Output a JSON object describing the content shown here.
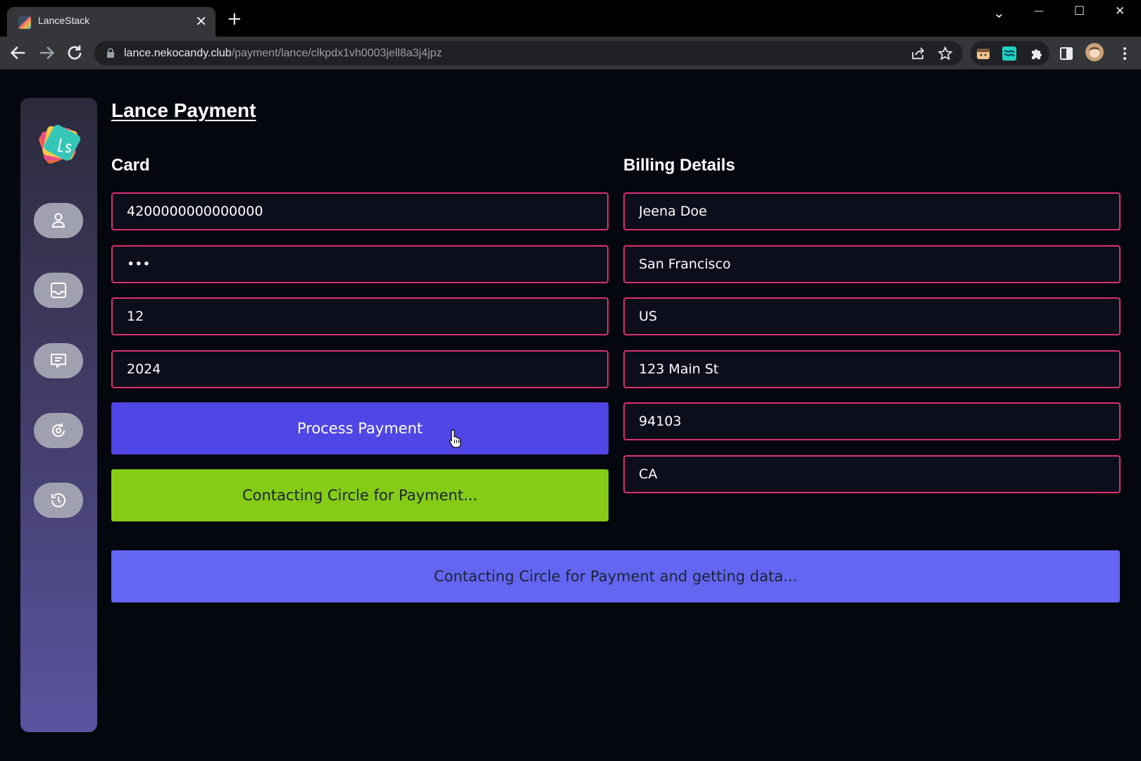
{
  "browser": {
    "tab_title": "LanceStack",
    "tab_close": "✕",
    "new_tab": "+",
    "url_domain": "lance.nekocandy.club",
    "url_path": "/payment/lance/clkpdx1vh0003jell8a3j4jpz",
    "window_controls": [
      "⌄",
      "—",
      "☐",
      "✕"
    ]
  },
  "page": {
    "title": "Lance Payment",
    "card_section_title": "Card",
    "billing_section_title": "Billing Details"
  },
  "card_fields": {
    "number": "4200000000000000",
    "cvv": "•••",
    "exp_month": "12",
    "exp_year": "2024"
  },
  "billing_fields": {
    "name": "Jeena Doe",
    "city": "San Francisco",
    "country": "US",
    "address": "123 Main St",
    "postal_code": "94103",
    "district": "CA"
  },
  "buttons": {
    "process_payment": "Process Payment",
    "contacting": "Contacting Circle for Payment..."
  },
  "status": {
    "message": "Contacting Circle for Payment and getting data..."
  },
  "sidebar": {
    "items": [
      "user-icon",
      "inbox-icon",
      "chat-icon",
      "refresh-icon",
      "history-icon"
    ]
  },
  "colors": {
    "background": "#05070f",
    "field_border": "#d8306d",
    "process_button": "#4f46e5",
    "contacting_button": "#84cc16",
    "status_bar": "#6366f1"
  }
}
